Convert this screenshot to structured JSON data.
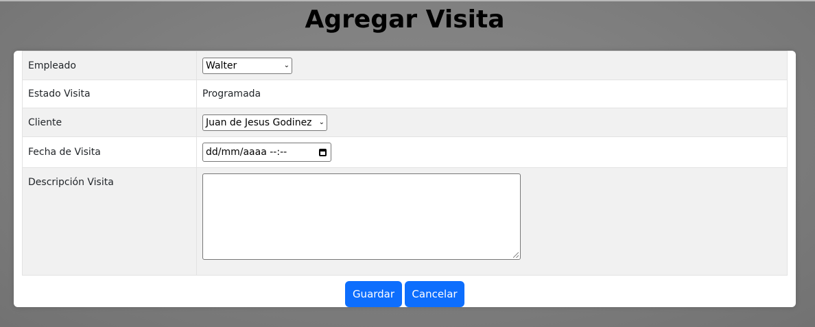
{
  "page": {
    "title": "Agregar Visita"
  },
  "form": {
    "empleado": {
      "label": "Empleado",
      "selected": "Walter"
    },
    "estado_visita": {
      "label": "Estado Visita",
      "value": "Programada"
    },
    "cliente": {
      "label": "Cliente",
      "selected": "Juan de Jesus Godinez"
    },
    "fecha_visita": {
      "label": "Fecha de Visita",
      "placeholder": "dd/mm/aaaa --:--"
    },
    "descripcion_visita": {
      "label": "Descripción Visita",
      "value": ""
    }
  },
  "actions": {
    "save_label": "Guardar",
    "cancel_label": "Cancelar"
  },
  "colors": {
    "primary_button": "#0d6efd",
    "row_shaded": "#f1f1f1",
    "backdrop": "#7a7a7a"
  },
  "icons": {
    "select_arrow": "chevron-down-icon",
    "date_picker": "calendar-icon",
    "textarea_resize": "resize-grip-icon"
  }
}
